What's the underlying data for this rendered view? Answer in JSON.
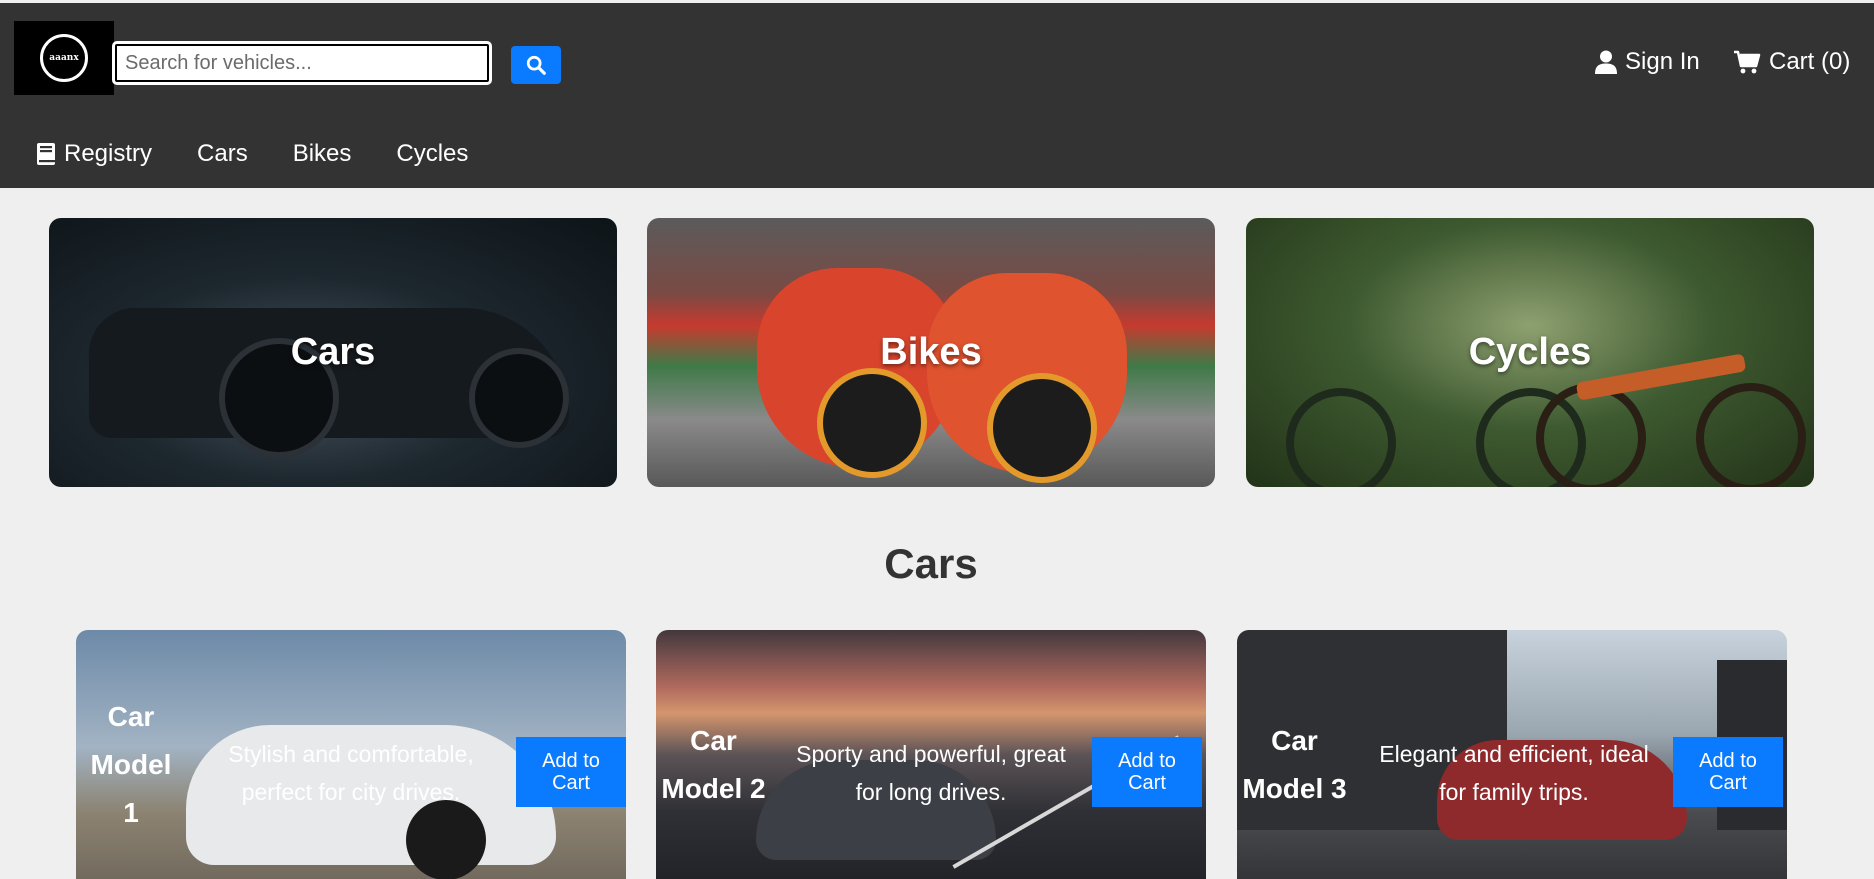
{
  "header": {
    "logo_text": "aaanx",
    "search_placeholder": "Search for vehicles...",
    "sign_in_label": "Sign In",
    "cart_label": "Cart (0)"
  },
  "nav": {
    "items": [
      {
        "label": "Registry",
        "icon": "book-icon"
      },
      {
        "label": "Cars"
      },
      {
        "label": "Bikes"
      },
      {
        "label": "Cycles"
      }
    ]
  },
  "categories": [
    {
      "label": "Cars"
    },
    {
      "label": "Bikes"
    },
    {
      "label": "Cycles"
    }
  ],
  "section": {
    "title": "Cars"
  },
  "products": [
    {
      "name_lines": [
        "Car",
        "Model",
        "1"
      ],
      "description_lines": [
        "Stylish and comfortable,",
        "perfect for city drives."
      ],
      "button_lines": [
        "Add to",
        "Cart"
      ]
    },
    {
      "name_lines": [
        "Car",
        "Model 2"
      ],
      "description_lines": [
        "Sporty and powerful, great",
        "for long drives."
      ],
      "button_lines": [
        "Add to",
        "Cart"
      ]
    },
    {
      "name_lines": [
        "Car",
        "Model 3"
      ],
      "description_lines": [
        "Elegant and efficient, ideal",
        "for family trips."
      ],
      "button_lines": [
        "Add to",
        "Cart"
      ]
    }
  ],
  "colors": {
    "header_bg": "#333333",
    "accent": "#0a7bff",
    "page_bg": "#efefef"
  }
}
